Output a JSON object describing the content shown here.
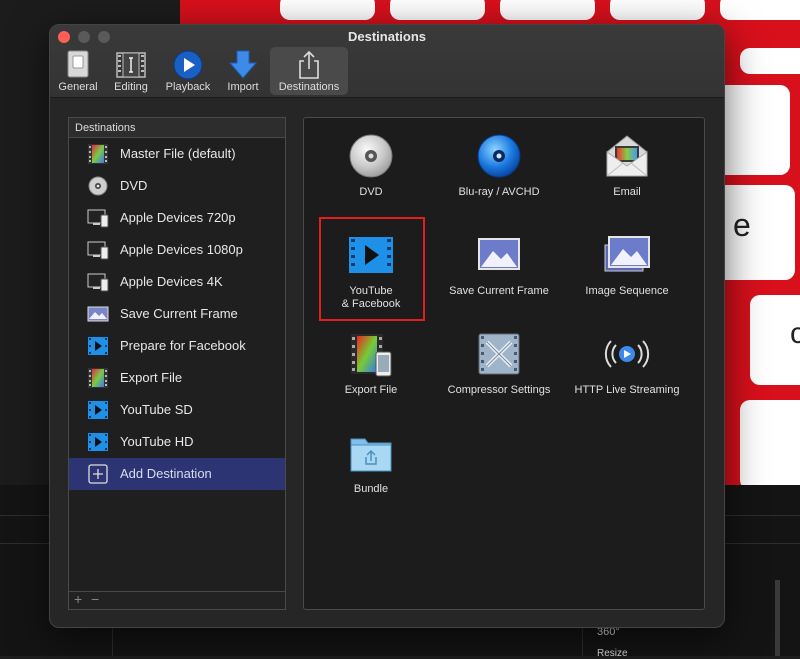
{
  "window": {
    "title": "Destinations"
  },
  "toolbar": {
    "items": [
      {
        "label": "General",
        "icon": "switch-icon"
      },
      {
        "label": "Editing",
        "icon": "film-strip-icon"
      },
      {
        "label": "Playback",
        "icon": "play-icon"
      },
      {
        "label": "Import",
        "icon": "download-arrow-icon"
      },
      {
        "label": "Destinations",
        "icon": "share-icon",
        "selected": true
      }
    ]
  },
  "sidebar": {
    "header": "Destinations",
    "items": [
      {
        "label": "Master File (default)",
        "icon": "film-color-icon"
      },
      {
        "label": "DVD",
        "icon": "disc-icon"
      },
      {
        "label": "Apple Devices 720p",
        "icon": "devices-icon"
      },
      {
        "label": "Apple Devices 1080p",
        "icon": "devices-icon"
      },
      {
        "label": "Apple Devices 4K",
        "icon": "devices-icon"
      },
      {
        "label": "Save Current Frame",
        "icon": "frame-image-icon"
      },
      {
        "label": "Prepare for Facebook",
        "icon": "video-play-icon"
      },
      {
        "label": "Export File",
        "icon": "film-color-icon"
      },
      {
        "label": "YouTube SD",
        "icon": "video-play-icon"
      },
      {
        "label": "YouTube HD",
        "icon": "video-play-icon"
      },
      {
        "label": "Add Destination",
        "icon": "plus-square-icon",
        "selected": true
      }
    ],
    "footer": {
      "add": "+",
      "remove": "−"
    }
  },
  "grid": {
    "items": [
      {
        "label": "DVD",
        "icon": "dvd-disc-icon"
      },
      {
        "label": "Blu-ray / AVCHD",
        "icon": "bluray-disc-icon"
      },
      {
        "label": "Email",
        "icon": "envelope-icon"
      },
      {
        "label": "YouTube\n& Facebook",
        "icon": "video-play-icon",
        "highlighted": true
      },
      {
        "label": "Save Current Frame",
        "icon": "frame-image-icon"
      },
      {
        "label": "Image Sequence",
        "icon": "image-stack-icon"
      },
      {
        "label": "Export File",
        "icon": "film-phone-icon"
      },
      {
        "label": "Compressor Settings",
        "icon": "compressor-icon"
      },
      {
        "label": "HTTP Live Streaming",
        "icon": "broadcast-icon"
      },
      {
        "label": "Bundle",
        "icon": "folder-icon"
      }
    ]
  },
  "background": {
    "keys": [
      "e",
      "c"
    ],
    "panel_labels": [
      "360°",
      "Resize"
    ]
  },
  "colors": {
    "selected_row": "#2c3473",
    "highlight_border": "#e02020",
    "close_button": "#fe5f57",
    "keyboard_red": "#d8101c"
  }
}
